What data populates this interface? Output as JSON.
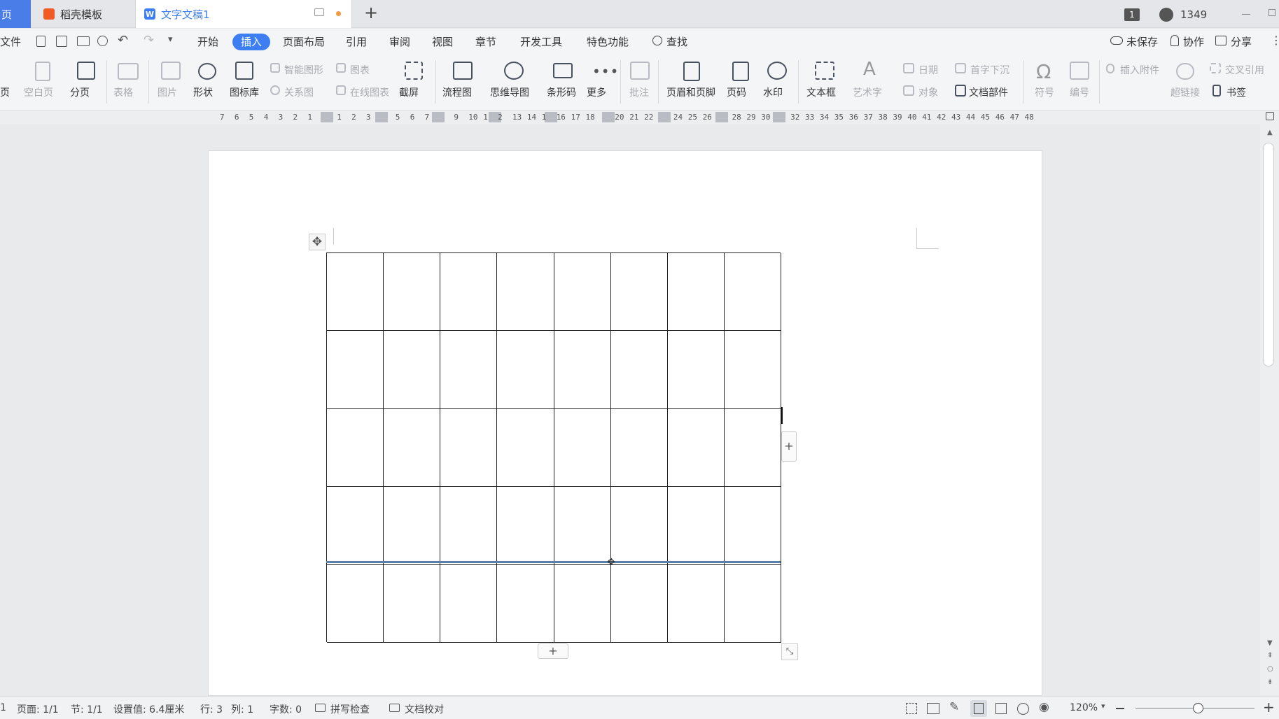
{
  "tabs": {
    "home": "页",
    "template": "稻壳模板",
    "doc": "文字文稿1",
    "new_tab": "+"
  },
  "title_right": {
    "badge": "1",
    "count": "1349"
  },
  "menu": {
    "file": "文件",
    "items": [
      "开始",
      "插入",
      "页面布局",
      "引用",
      "审阅",
      "视图",
      "章节",
      "开发工具",
      "特色功能",
      "查找"
    ],
    "unsaved": "未保存",
    "collab": "协作",
    "share": "分享"
  },
  "ribbon": {
    "blank": "空白页",
    "pagebreak": "分页",
    "table": "表格",
    "picture": "图片",
    "shape": "形状",
    "iconlib": "图标库",
    "smartart": "智能图形",
    "chart": "图表",
    "relation": "关系图",
    "online_chart": "在线图表",
    "screenshot": "截屏",
    "flowchart": "流程图",
    "mindmap": "思维导图",
    "barcode": "条形码",
    "more": "更多",
    "comment": "批注",
    "headerfooter": "页眉和页脚",
    "pagenum": "页码",
    "watermark": "水印",
    "textbox": "文本框",
    "wordart": "艺术字",
    "date": "日期",
    "dropcap": "首字下沉",
    "object": "对象",
    "docparts": "文档部件",
    "symbol": "符号",
    "number": "编号",
    "attach": "插入附件",
    "crossref": "交叉引用",
    "hyperlink": "超链接",
    "bookmark": "书签",
    "left_cut": "页"
  },
  "ruler": [
    "7",
    "6",
    "5",
    "4",
    "3",
    "2",
    "1",
    "",
    "1",
    "2",
    "3",
    "",
    "5",
    "6",
    "7",
    "",
    "9",
    "10",
    "1",
    "2",
    "13",
    "14",
    "1",
    "16",
    "17",
    "18",
    "",
    "20",
    "21",
    "22",
    "",
    "24",
    "25",
    "26",
    "",
    "28",
    "29",
    "30",
    "",
    "32",
    "33",
    "34",
    "35",
    "36",
    "37",
    "38",
    "39",
    "40",
    "41",
    "42",
    "43",
    "44",
    "45",
    "46",
    "47",
    "48"
  ],
  "table": {
    "rows": 5,
    "cols": 8
  },
  "status": {
    "left": "1",
    "page": "页面: 1/1",
    "section": "节: 1/1",
    "setting": "设置值: 6.4厘米",
    "row": "行: 3",
    "col": "列: 1",
    "words": "字数: 0",
    "spell": "拼写检查",
    "proof": "文档校对",
    "zoom": "120%"
  }
}
